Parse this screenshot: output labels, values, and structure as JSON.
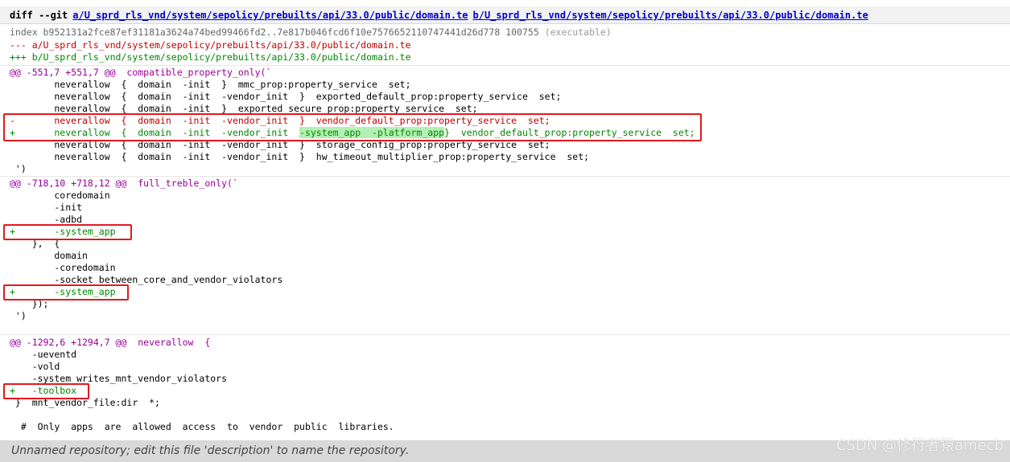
{
  "header": {
    "diff_label": "diff --git",
    "file_a": "a/U_sprd_rls_vnd/system/sepolicy/prebuilts/api/33.0/public/domain.te",
    "file_b": "b/U_sprd_rls_vnd/system/sepolicy/prebuilts/api/33.0/public/domain.te"
  },
  "index_line": "index b952131a2fce87ef31181a3624a74bed99466fd2..7e817b046fcd6f10e7576652110747441d26d778 100755",
  "index_mode_note": "(executable)",
  "from_file": "--- a/U_sprd_rls_vnd/system/sepolicy/prebuilts/api/33.0/public/domain.te",
  "to_file": "+++ b/U_sprd_rls_vnd/system/sepolicy/prebuilts/api/33.0/public/domain.te",
  "hunk1": {
    "header": "@@ -551,7 +551,7 @@  compatible_property_only(`",
    "ctx1": "        neverallow  {  domain  -init  }  mmc_prop:property_service  set;",
    "ctx2": "        neverallow  {  domain  -init  -vendor_init  }  exported_default_prop:property_service  set;",
    "ctx3": "        neverallow  {  domain  -init  }  exported_secure_prop:property_service  set;",
    "removed": "-       neverallow  {  domain  -init  -vendor_init  }  vendor_default_prop:property_service  set;",
    "added_prefix": "+       neverallow  {  domain  -init  -vendor_init  ",
    "added_highlight": "-system_app  -platform_app",
    "added_suffix": "}  vendor_default_prop:property_service  set;",
    "ctx4": "        neverallow  {  domain  -init  -vendor_init  }  storage_config_prop:property_service  set;",
    "ctx5": "        neverallow  {  domain  -init  -vendor_init  }  hw_timeout_multiplier_prop:property_service  set;",
    "ctx6": " ')"
  },
  "hunk2": {
    "header": "@@ -718,10 +718,12 @@  full_treble_only(`",
    "ctx1": "        coredomain",
    "ctx2": "        -init",
    "ctx3": "        -adbd",
    "added1": "+       -system_app",
    "ctx4": "    },  {",
    "ctx5": "        domain",
    "ctx6": "        -coredomain",
    "ctx7": "        -socket_between_core_and_vendor_violators",
    "added2": "+       -system_app",
    "ctx8": "    });",
    "ctx9": " ')"
  },
  "hunk3": {
    "header": "@@ -1292,6 +1294,7 @@  neverallow  {",
    "ctx1": "    -ueventd",
    "ctx2": "    -vold",
    "ctx3": "    -system_writes_mnt_vendor_violators",
    "added1": "+   -toolbox",
    "ctx4": " }  mnt_vendor_file:dir  *;",
    "ctx5": "",
    "ctx6": "  #  Only  apps  are  allowed  access  to  vendor  public  libraries."
  },
  "footer_text": "Unnamed repository; edit this file 'description' to name the repository.",
  "watermark": "CSDN @修行者猿amecb",
  "colors": {
    "removed": "#c00000",
    "added": "#008800",
    "chunk_header": "#990099",
    "added_highlight": "#b4f0b4",
    "annotation_box": "#e3191f",
    "link": "#0000cc"
  }
}
